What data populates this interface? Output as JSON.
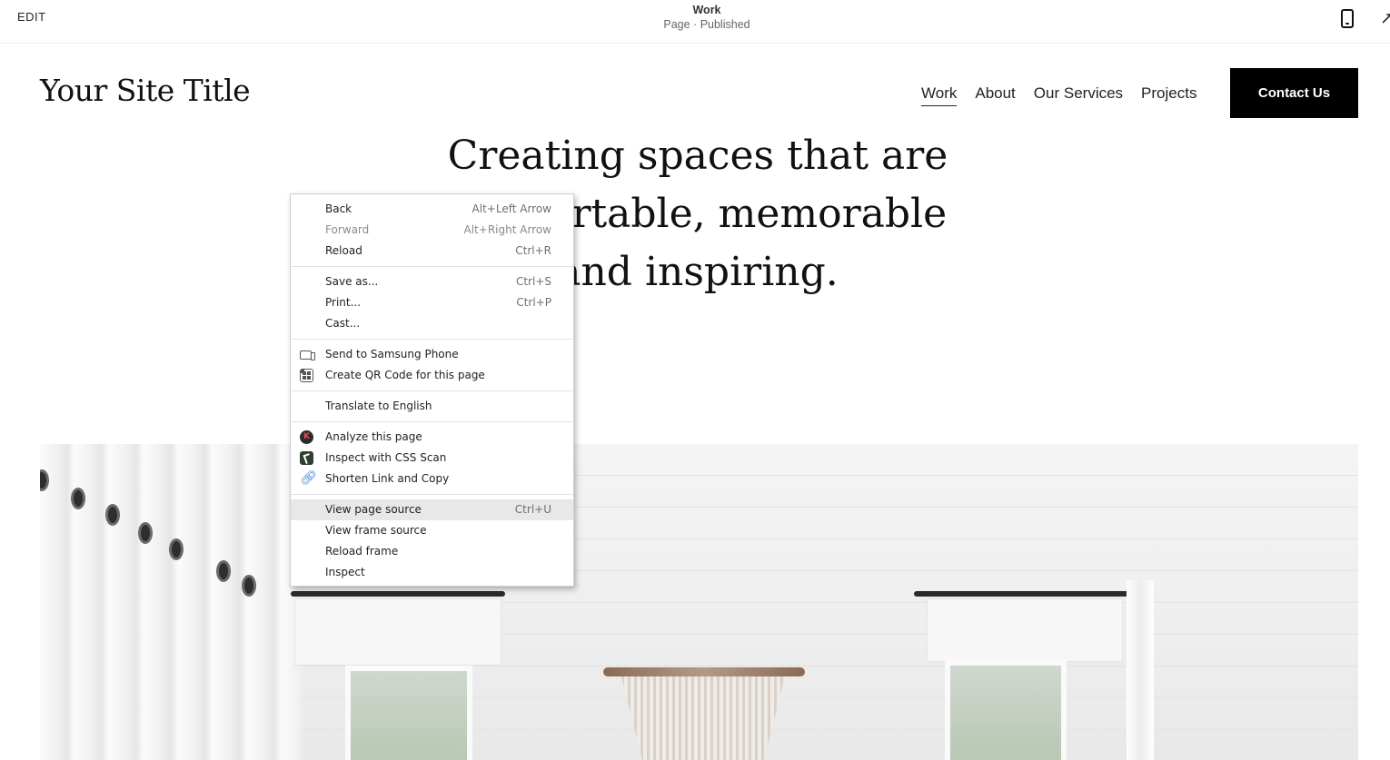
{
  "editor_bar": {
    "edit_label": "EDIT",
    "page_title": "Work",
    "page_status": "Page · Published",
    "mobile_icon": "mobile-preview-icon",
    "expand_icon": "expand-icon"
  },
  "site": {
    "title": "Your Site Title",
    "nav": [
      {
        "label": "Work",
        "active": true
      },
      {
        "label": "About"
      },
      {
        "label": "Our Services"
      },
      {
        "label": "Projects"
      }
    ],
    "contact_label": "Contact Us"
  },
  "hero": {
    "heading": "Creating spaces that are comfortable, memorable and inspiring."
  },
  "context_menu": {
    "back": {
      "label": "Back",
      "shortcut": "Alt+Left Arrow"
    },
    "forward": {
      "label": "Forward",
      "shortcut": "Alt+Right Arrow",
      "disabled": true
    },
    "reload": {
      "label": "Reload",
      "shortcut": "Ctrl+R"
    },
    "save_as": {
      "label": "Save as...",
      "shortcut": "Ctrl+S"
    },
    "print": {
      "label": "Print...",
      "shortcut": "Ctrl+P"
    },
    "cast": {
      "label": "Cast..."
    },
    "send_to_phone": {
      "label": "Send to Samsung Phone",
      "icon": "device-send-icon"
    },
    "qr_code": {
      "label": "Create QR Code for this page",
      "icon": "qr-code-icon"
    },
    "translate": {
      "label": "Translate to English"
    },
    "analyze": {
      "label": "Analyze this page",
      "icon": "k-extension-icon",
      "icon_glyph": "K"
    },
    "css_scan": {
      "label": "Inspect with CSS Scan",
      "icon": "css-scan-icon"
    },
    "shorten_link": {
      "label": "Shorten Link and Copy",
      "icon": "link-icon"
    },
    "view_source": {
      "label": "View page source",
      "shortcut": "Ctrl+U",
      "highlighted": true
    },
    "view_frame_source": {
      "label": "View frame source"
    },
    "reload_frame": {
      "label": "Reload frame"
    },
    "inspect": {
      "label": "Inspect"
    }
  },
  "colors": {
    "contact_button_bg": "#000000",
    "menu_highlight": "#e8e8e8",
    "link_icon": "#3b7bdc"
  }
}
